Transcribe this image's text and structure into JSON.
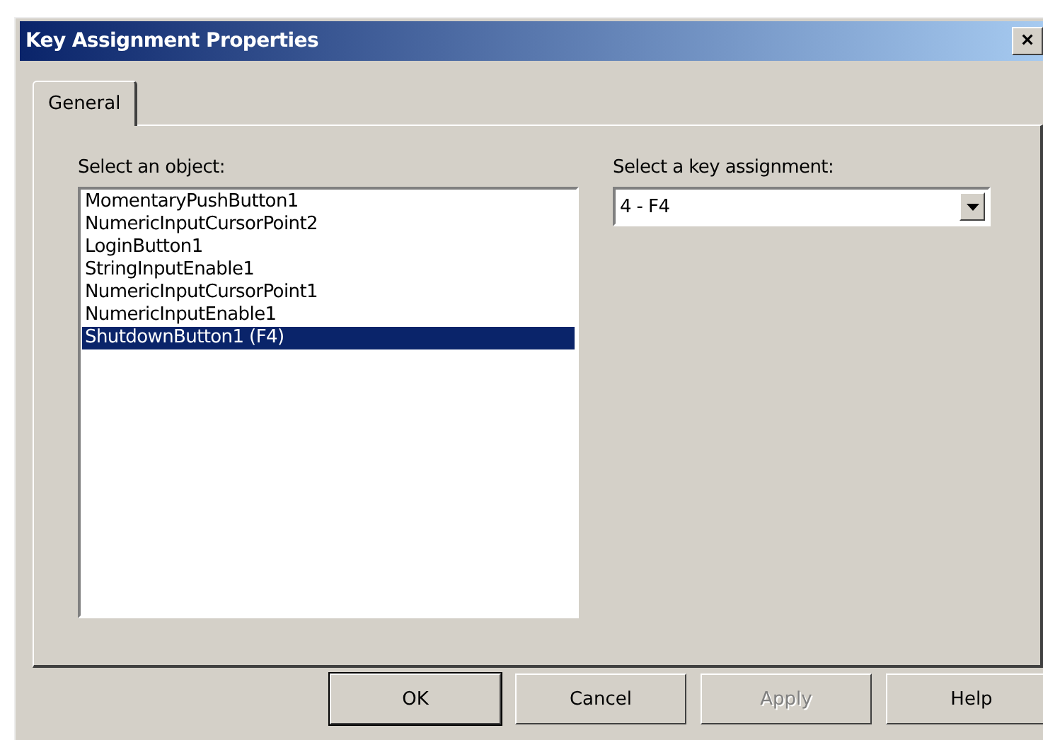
{
  "window": {
    "title": "Key Assignment Properties",
    "close": "×"
  },
  "tabs": [
    {
      "label": "General",
      "selected": true
    }
  ],
  "object_list": {
    "label": "Select an object:",
    "items": [
      {
        "text": "MomentaryPushButton1",
        "selected": false
      },
      {
        "text": "NumericInputCursorPoint2",
        "selected": false
      },
      {
        "text": "LoginButton1",
        "selected": false
      },
      {
        "text": "StringInputEnable1",
        "selected": false
      },
      {
        "text": "NumericInputCursorPoint1",
        "selected": false
      },
      {
        "text": "NumericInputEnable1",
        "selected": false
      },
      {
        "text": "ShutdownButton1 (F4)",
        "selected": true
      }
    ]
  },
  "key_assignment": {
    "label": "Select a key assignment:",
    "value": "4 - F4"
  },
  "buttons": [
    {
      "label": "OK",
      "default": true,
      "disabled": false
    },
    {
      "label": "Cancel",
      "default": false,
      "disabled": false
    },
    {
      "label": "Apply",
      "default": false,
      "disabled": true
    },
    {
      "label": "Help",
      "default": false,
      "disabled": false
    }
  ]
}
